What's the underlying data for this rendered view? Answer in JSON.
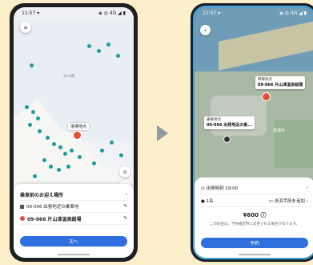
{
  "left_phone": {
    "status": {
      "time": "11:57 ▾",
      "icons": "◈ ◎ 4G ◢ ▮"
    },
    "map_labels": [
      "大山町"
    ],
    "badge": "境港地点",
    "sheet": {
      "title": "乗車前のお迎え場所",
      "row1": "09-006 出発地近の乗車地",
      "row2": "09-066 片山津温泉総場",
      "button": "次へ"
    }
  },
  "right_phone": {
    "status": {
      "time": "11:57 ▾",
      "icons": "◈ ◎ 4G ◢ ▮"
    },
    "dest_card": {
      "caption": "降車地点",
      "id": "09-066 片山津温泉総場"
    },
    "origin_card": {
      "caption": "乗車地点",
      "id": "09-066 出発地近の乗..."
    },
    "map_town": "境港市",
    "sheet": {
      "time": "出発時刻 19:00",
      "passengers": "1名",
      "options": "決済手段を追加",
      "fare": "¥600 ⓘ",
      "note": "この料金は、予約確定時に変更される場合があります。",
      "button": "予約"
    }
  },
  "arrow_color": "#8f9aa6"
}
